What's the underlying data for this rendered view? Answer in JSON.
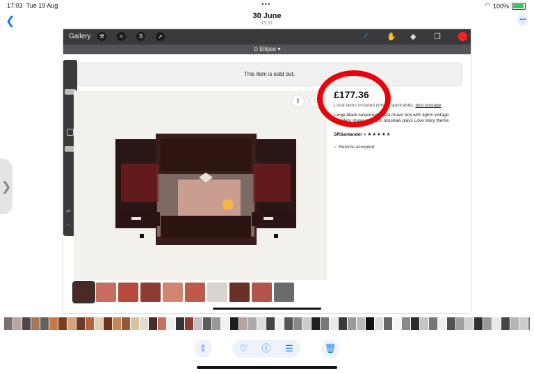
{
  "status": {
    "time": "17:03",
    "date": "Tue 19 Aug",
    "battery": "100%"
  },
  "header": {
    "title": "30 June",
    "subtitle": "15:31"
  },
  "toolbar": {
    "gallery_label": "Gallery",
    "mode_label": "Ellipse",
    "mode_chevron": "▾",
    "accent_color": "#ff2020"
  },
  "listing": {
    "sold_notice": "This item is sold out.",
    "price": "£177.36",
    "tax_note": "Local taxes included (where applicable),",
    "tax_link": "plus postage",
    "description": "Large black lacquered chest music box with lights vintage jewellery music box with rickshaw plays Love story theme",
    "seller": "SRSantander",
    "rating": "★★★★★",
    "returns": "Returns accepted"
  },
  "thumb_colors": [
    "#4a2a25",
    "#c96d61",
    "#b74a3d",
    "#8e3b31",
    "#d08570",
    "#bf5a48",
    "#d9d4cf",
    "#6b3025",
    "#b2554b",
    "#6b6b6b"
  ],
  "strip_colors": [
    "#7b6f6a",
    "#b7a49e",
    "#4f4544",
    "#a5775a",
    "#66605d",
    "#c27a40",
    "#7d3d1d",
    "#d4a373",
    "#6b3b2c",
    "#b8623b",
    "#e2d0b3",
    "#713320",
    "#c48a55",
    "#975838",
    "#d9c2a4",
    "#e1dacf",
    "#4a2a25",
    "#c96d61",
    "#eeeeee",
    "#333333",
    "#8e3b31",
    "#c2c2c2",
    "#5c5c5c",
    "#999999",
    "#f2f2f2",
    "#1e1e1e",
    "#b7a49e",
    "#aaaaaa",
    "#dddddd",
    "#444444",
    "#f0f0f0",
    "#555555",
    "#888888",
    "#cccccc",
    "#202020",
    "#777777",
    "#eaeaea",
    "#3a3a3a",
    "#999999",
    "#bbbbbb",
    "#111111",
    "#dcdcdc",
    "#666666",
    "#f5f5f5",
    "#8a8a8a",
    "#2c2c2c",
    "#c5c5c5",
    "#777777",
    "#eeeeee",
    "#505050",
    "#a0a0a0",
    "#d0d0d0",
    "#303030",
    "#9a9a9a",
    "#e8e8e8",
    "#474747",
    "#b5b5b5",
    "#cccccc",
    "#6e6e6e",
    "#f1f1f1"
  ]
}
